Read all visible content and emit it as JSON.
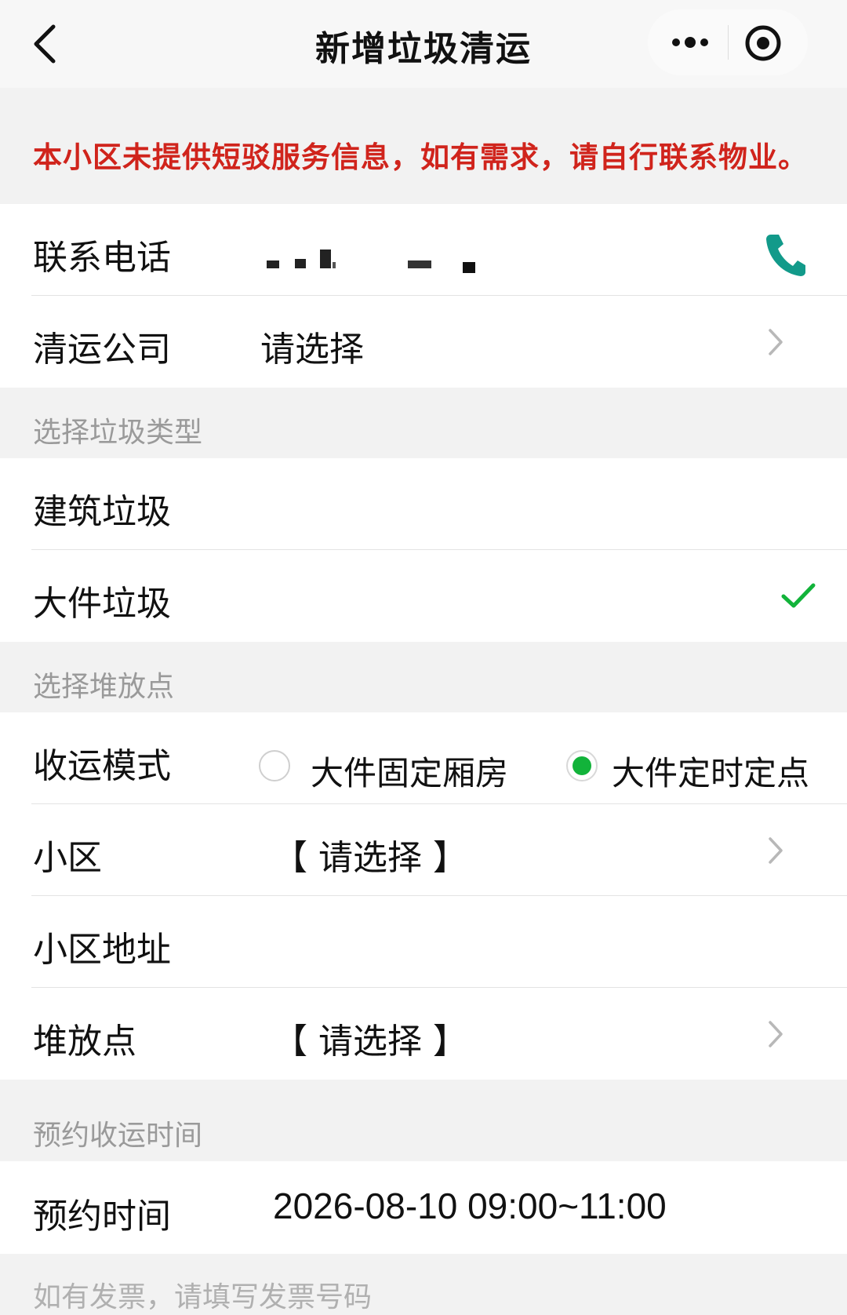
{
  "nav": {
    "title": "新增垃圾清运"
  },
  "notice": "本小区未提供短驳服务信息，如有需求，请自行联系物业。",
  "contact": {
    "phone_label": "联系电话",
    "company_label": "清运公司",
    "company_value": "请选择"
  },
  "garbage_type": {
    "header": "选择垃圾类型",
    "options": [
      {
        "label": "建筑垃圾",
        "selected": false
      },
      {
        "label": "大件垃圾",
        "selected": true
      }
    ]
  },
  "drop_point": {
    "header": "选择堆放点",
    "mode_label": "收运模式",
    "modes": [
      {
        "label": "大件固定厢房",
        "checked": false
      },
      {
        "label": "大件定时定点",
        "checked": true
      }
    ],
    "community_label": "小区",
    "community_value": "【 请选择 】",
    "address_label": "小区地址",
    "point_label": "堆放点",
    "point_value": "【 请选择 】"
  },
  "appointment": {
    "header": "预约收运时间",
    "time_label": "预约时间",
    "time_value": "2026-08-10  09:00~11:00"
  },
  "invoice_hint": "如有发票，请填写发票号码",
  "colors": {
    "notice_red": "#d0241c",
    "accent_green": "#12b33a",
    "phone_teal": "#129a8a"
  }
}
